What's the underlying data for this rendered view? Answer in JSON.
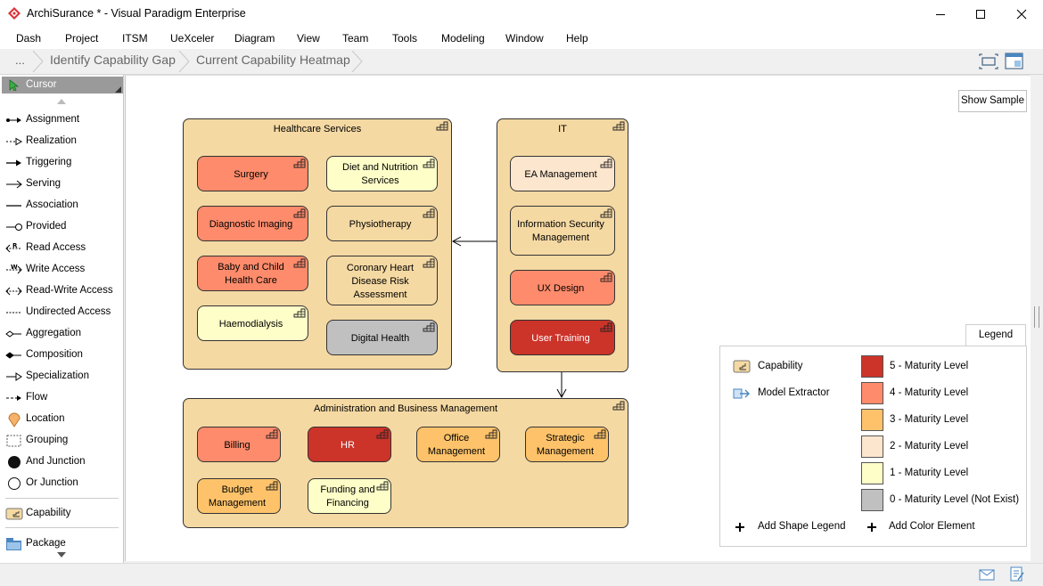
{
  "window": {
    "title": "ArchiSurance * - Visual Paradigm Enterprise"
  },
  "menu": [
    "Dash",
    "Project",
    "ITSM",
    "UeXceler",
    "Diagram",
    "View",
    "Team",
    "Tools",
    "Modeling",
    "Window",
    "Help"
  ],
  "breadcrumb": {
    "more": "...",
    "items": [
      "Identify Capability Gap",
      "Current Capability Heatmap"
    ]
  },
  "palette": {
    "cursor": "Cursor",
    "items": [
      "Assignment",
      "Realization",
      "Triggering",
      "Serving",
      "Association",
      "Provided",
      "Read Access",
      "Write Access",
      "Read-Write Access",
      "Undirected Access",
      "Aggregation",
      "Composition",
      "Specialization",
      "Flow",
      "Location",
      "Grouping",
      "And Junction",
      "Or Junction",
      "Capability",
      "Package"
    ]
  },
  "toolbar": {
    "show_sample": "Show Sample"
  },
  "diagram": {
    "groups": {
      "healthcare": "Healthcare Services",
      "it": "IT",
      "admin": "Administration and Business Management"
    },
    "capabilities": {
      "surgery": "Surgery",
      "diet": "Diet and Nutrition Services",
      "diagnostic": "Diagnostic Imaging",
      "physio": "Physiotherapy",
      "baby": "Baby and Child Health Care",
      "coronary": "Coronary Heart Disease Risk Assessment",
      "haemo": "Haemodialysis",
      "digital": "Digital Health",
      "ea": "EA Management",
      "infosec": "Information Security Management",
      "ux": "UX Design",
      "training": "User Training",
      "billing": "Billing",
      "hr": "HR",
      "office": "Office Management",
      "strategic": "Strategic Management",
      "budget": "Budget Management",
      "funding": "Funding and Financing"
    }
  },
  "legend": {
    "tab": "Legend",
    "shapes": [
      "Capability",
      "Model Extractor"
    ],
    "colors": [
      {
        "label": "5 - Maturity Level",
        "color": "#cc3329"
      },
      {
        "label": "4 - Maturity Level",
        "color": "#fe8b6b"
      },
      {
        "label": "3 - Maturity Level",
        "color": "#fec36a"
      },
      {
        "label": "2 - Maturity Level",
        "color": "#fde6ce"
      },
      {
        "label": "1 - Maturity Level",
        "color": "#fefec8"
      },
      {
        "label": "0 - Maturity Level (Not Exist)",
        "color": "#c0c0c0"
      }
    ],
    "add_shape": "Add Shape Legend",
    "add_color": "Add Color Element"
  },
  "colors": {
    "group_fill": "#f5d9a3",
    "level5": "#cc3329",
    "level4": "#fe8b6b",
    "level3": "#fec36a",
    "level2": "#fde6ce",
    "level1": "#fefec8",
    "level0": "#c0c0c0"
  }
}
